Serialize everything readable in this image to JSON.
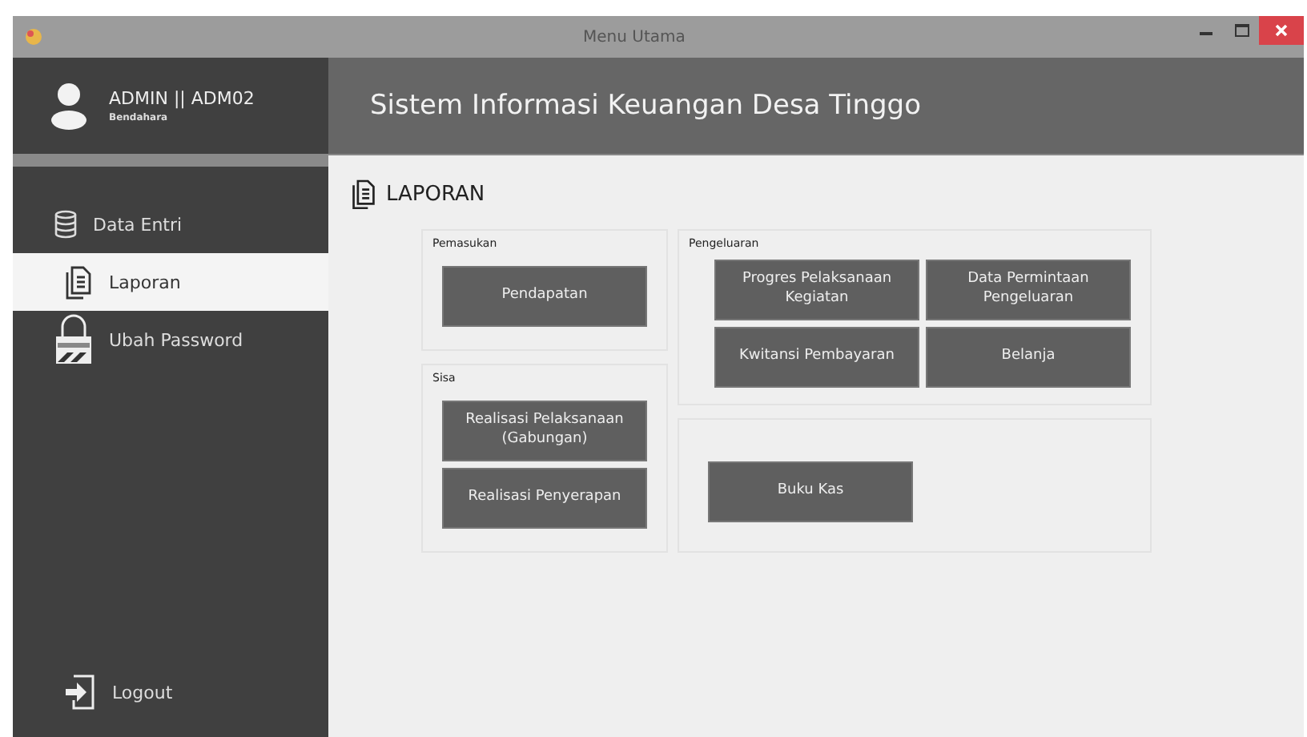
{
  "window": {
    "title": "Menu Utama"
  },
  "user": {
    "name": "ADMIN || ADM02",
    "role": "Bendahara"
  },
  "sidebar": {
    "items": [
      {
        "label": "Data Entri",
        "selected": false
      },
      {
        "label": "Laporan",
        "selected": true
      },
      {
        "label": "Ubah Password",
        "selected": false
      }
    ],
    "logout": "Logout"
  },
  "header": {
    "title": "Sistem Informasi Keuangan Desa Tinggo"
  },
  "page": {
    "title": "LAPORAN"
  },
  "columns": [
    {
      "groups": [
        {
          "title": "Pemasukan",
          "buttons": [
            "Pendapatan"
          ]
        },
        {
          "title": "Sisa",
          "buttons": [
            "Realisasi Pelaksanaan (Gabungan)",
            "Realisasi Penyerapan"
          ]
        }
      ]
    },
    {
      "groups": [
        {
          "title": "Pengeluaran",
          "buttons": [
            "Progres Pelaksanaan Kegiatan",
            "Data Permintaan Pengeluaran",
            "Kwitansi Pembayaran",
            "Belanja"
          ]
        },
        {
          "buttons": [
            "Buku Kas"
          ]
        }
      ]
    }
  ]
}
